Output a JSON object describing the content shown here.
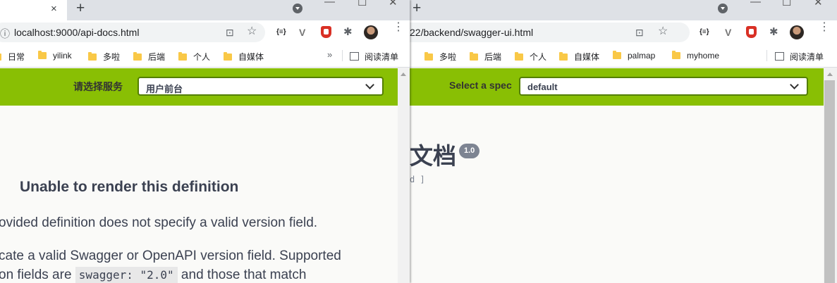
{
  "left_window": {
    "url": "localhost:9000/api-docs.html",
    "bookmarks": [
      "日常",
      "yilink",
      "多啦",
      "后端",
      "个人",
      "自媒体"
    ],
    "overflow_chevron": "»",
    "reading_list": "阅读清单",
    "select_label": "请选择服务",
    "select_value": "用户前台",
    "error_title": "Unable to render this definition",
    "error_line1": "ovided definition does not specify a valid version field.",
    "error_line2": "cate a valid Swagger or OpenAPI version field. Supported",
    "error_line3_prefix": "on fields are ",
    "error_code": "swagger: \"2.0\"",
    "error_line3_suffix": " and those that match"
  },
  "right_window": {
    "url": "22/backend/swagger-ui.html",
    "bookmarks": [
      "多啦",
      "后端",
      "个人",
      "自媒体",
      "palmap",
      "myhome"
    ],
    "reading_list": "阅读清单",
    "select_label": "Select a spec",
    "select_value": "default",
    "doc_title": "文档",
    "version": "1.0",
    "base_url": "d ]"
  },
  "icons": {
    "tab_close": "×",
    "new_tab": "+",
    "minimize": "—",
    "maximize": "☐",
    "close_window": "✕",
    "translate": "⊡",
    "star": "☆",
    "json_ext": "{≡}",
    "v_ext": "V",
    "puzzle": "✱",
    "menu": "⋮"
  },
  "colors": {
    "topbar": "#89bf04",
    "select_border": "#547f00",
    "badge": "#7d8492"
  }
}
